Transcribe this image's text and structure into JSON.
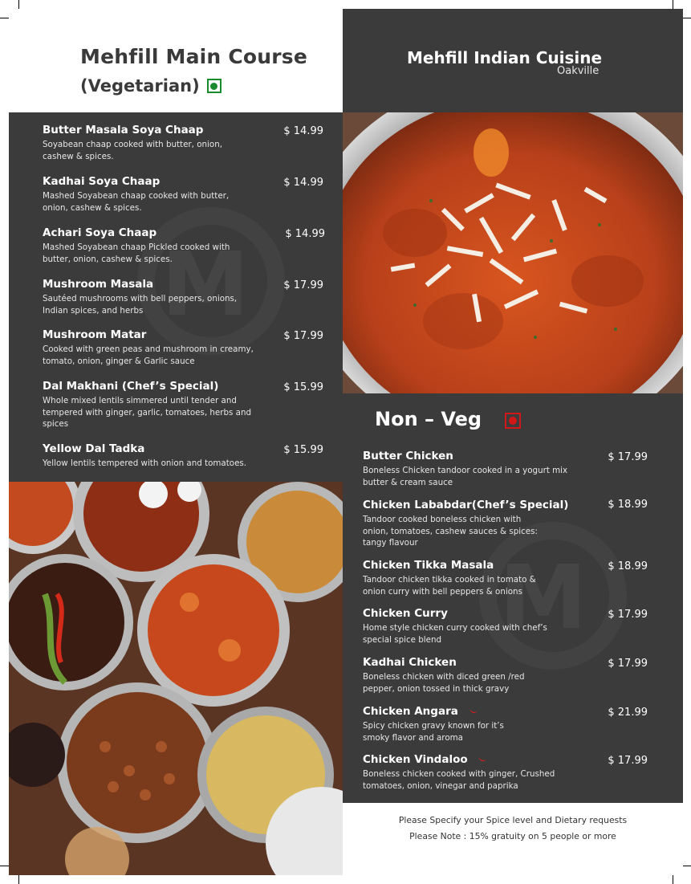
{
  "left_header": {
    "title": "Mehfill Main Course",
    "subtitle": "(Vegetarian)"
  },
  "right_header": {
    "title": "Mehfill Indian Cuisine",
    "location": "Oakville"
  },
  "veg_items": [
    {
      "name": "Butter Masala Soya Chaap",
      "price": "$ 14.99",
      "desc": "Soyabean chaap cooked with butter, onion, cashew & spices."
    },
    {
      "name": "Kadhai Soya Chaap",
      "price": "$ 14.99",
      "desc": "Mashed Soyabean chaap cooked with butter, onion, cashew & spices."
    },
    {
      "name": "Achari Soya Chaap",
      "price": "$ 14.99",
      "desc": "Mashed Soyabean chaap Pickled cooked with butter, onion, cashew & spices."
    },
    {
      "name": "Mushroom Masala",
      "price": "$ 17.99",
      "desc": "Sautéed mushrooms with bell peppers, onions, Indian spices, and herbs"
    },
    {
      "name": "Mushroom Matar",
      "price": "$ 17.99",
      "desc": "Cooked with green peas and  mushroom in creamy, tomato, onion, ginger & Garlic sauce"
    },
    {
      "name": "Dal Makhani (Chef’s Special)",
      "price": "$ 15.99",
      "desc": "Whole mixed lentils simmered until tender and tempered with ginger, garlic, tomatoes, herbs and spices"
    },
    {
      "name": "Yellow Dal Tadka",
      "price": "$ 15.99",
      "desc": "Yellow lentils tempered with onion and tomatoes."
    }
  ],
  "nonveg": {
    "title": "Non – Veg",
    "items": [
      {
        "name": "Butter Chicken",
        "price": "$ 17.99",
        "desc": "Boneless Chicken tandoor cooked in a yogurt mix butter & cream sauce"
      },
      {
        "name": "Chicken Lababdar(Chef’s Special)",
        "price": "$ 18.99",
        "desc": "Tandoor cooked boneless chicken with onion, tomatoes, cashew sauces & spices: tangy flavour"
      },
      {
        "name": "Chicken Tikka Masala",
        "price": "$ 18.99",
        "desc": "Tandoor chicken tikka cooked in tomato & onion curry with bell peppers & onions"
      },
      {
        "name": "Chicken Curry",
        "price": "$ 17.99",
        "desc": "Home style chicken curry cooked with chef’s special spice blend"
      },
      {
        "name": "Kadhai Chicken",
        "price": "$ 17.99",
        "desc": "Boneless chicken with diced green /red pepper, onion tossed in thick gravy"
      },
      {
        "name": "Chicken Angara",
        "price": "$ 21.99",
        "desc": "Spicy chicken gravy known for it’s smoky flavor and aroma",
        "spicy": true
      },
      {
        "name": "Chicken Vindaloo",
        "price": "$ 17.99",
        "desc": "Boneless chicken cooked with ginger, Crushed tomatoes, onion, vinegar and paprika",
        "spicy": true
      }
    ]
  },
  "notes": {
    "line1": "Please Specify your Spice level and Dietary requests",
    "line2": "Please Note : 15% gratuity on 5 people or more"
  },
  "icons": {
    "veg_mark": "veg-symbol-icon",
    "nonveg_mark": "nonveg-symbol-icon",
    "spicy": "chili-pepper-icon"
  },
  "colors": {
    "panel": "#3b3b3b",
    "veg": "#1a8a2e",
    "nonveg": "#d01818",
    "chili": "#d81e1e"
  }
}
